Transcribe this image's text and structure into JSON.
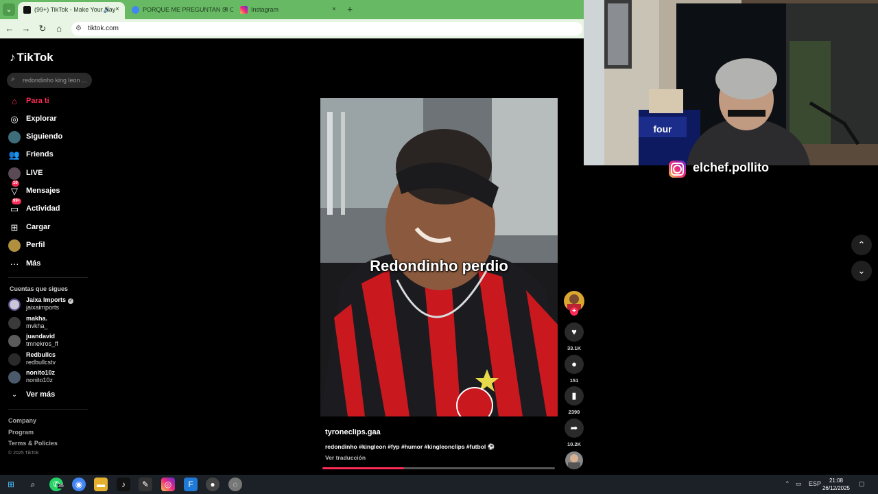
{
  "browser": {
    "tabs": [
      {
        "title": "(99+) TikTok - Make Your Day",
        "icon": "tiktok-icon",
        "active": true
      },
      {
        "title": "PORQUE ME PREGUNTAN SI CO",
        "icon": "chrome-icon",
        "active": false
      },
      {
        "title": "Instagram",
        "icon": "instagram-icon",
        "active": false
      }
    ],
    "url": "tiktok.com",
    "newtab_label": "+",
    "close_label": "×"
  },
  "sidebar": {
    "logo": "TikTok",
    "search_placeholder": "redondinho king leon ...",
    "nav": [
      {
        "label": "Para ti",
        "icon": "home-icon",
        "active": true
      },
      {
        "label": "Explorar",
        "icon": "compass-icon"
      },
      {
        "label": "Siguiendo",
        "icon": "following-avatar-icon"
      },
      {
        "label": "Friends",
        "icon": "friends-icon"
      },
      {
        "label": "LIVE",
        "icon": "live-icon"
      },
      {
        "label": "Mensajes",
        "icon": "messages-icon",
        "badge": "10"
      },
      {
        "label": "Actividad",
        "icon": "activity-icon",
        "badge": "99+"
      },
      {
        "label": "Cargar",
        "icon": "upload-icon"
      },
      {
        "label": "Perfil",
        "icon": "profile-icon"
      },
      {
        "label": "Más",
        "icon": "more-icon"
      }
    ],
    "following_title": "Cuentas que sigues",
    "following": [
      {
        "name": "Jaixa Imports",
        "handle": "jaixaimports",
        "verified": true
      },
      {
        "name": "makha.",
        "handle": "mvkha_"
      },
      {
        "name": "juandavid",
        "handle": "tmnekros_ff"
      },
      {
        "name": "Redbullcs",
        "handle": "redbullcstv"
      },
      {
        "name": "nonito10z",
        "handle": "nonito10z"
      }
    ],
    "see_more": "Ver más",
    "footer_links": [
      "Company",
      "Program",
      "Terms & Policies"
    ],
    "copyright": "© 2025 TikTok"
  },
  "video": {
    "caption": "Redondinho perdio",
    "author": "tyroneclips.gaa",
    "description": "redondinho #kingleon #fyp #humor #kingleonclips #futbol ⚽",
    "translate": "Ver traducción",
    "progress": 0.35
  },
  "actions": {
    "likes": "33.1K",
    "comments": "151",
    "saves": "2399",
    "shares": "10.2K"
  },
  "stream": {
    "ig_handle": "elchef.pollito",
    "sign_text": "four"
  },
  "taskbar": {
    "whatsapp_badge": "35",
    "language": "ESP",
    "time": "21:08",
    "date": "26/12/2025"
  }
}
